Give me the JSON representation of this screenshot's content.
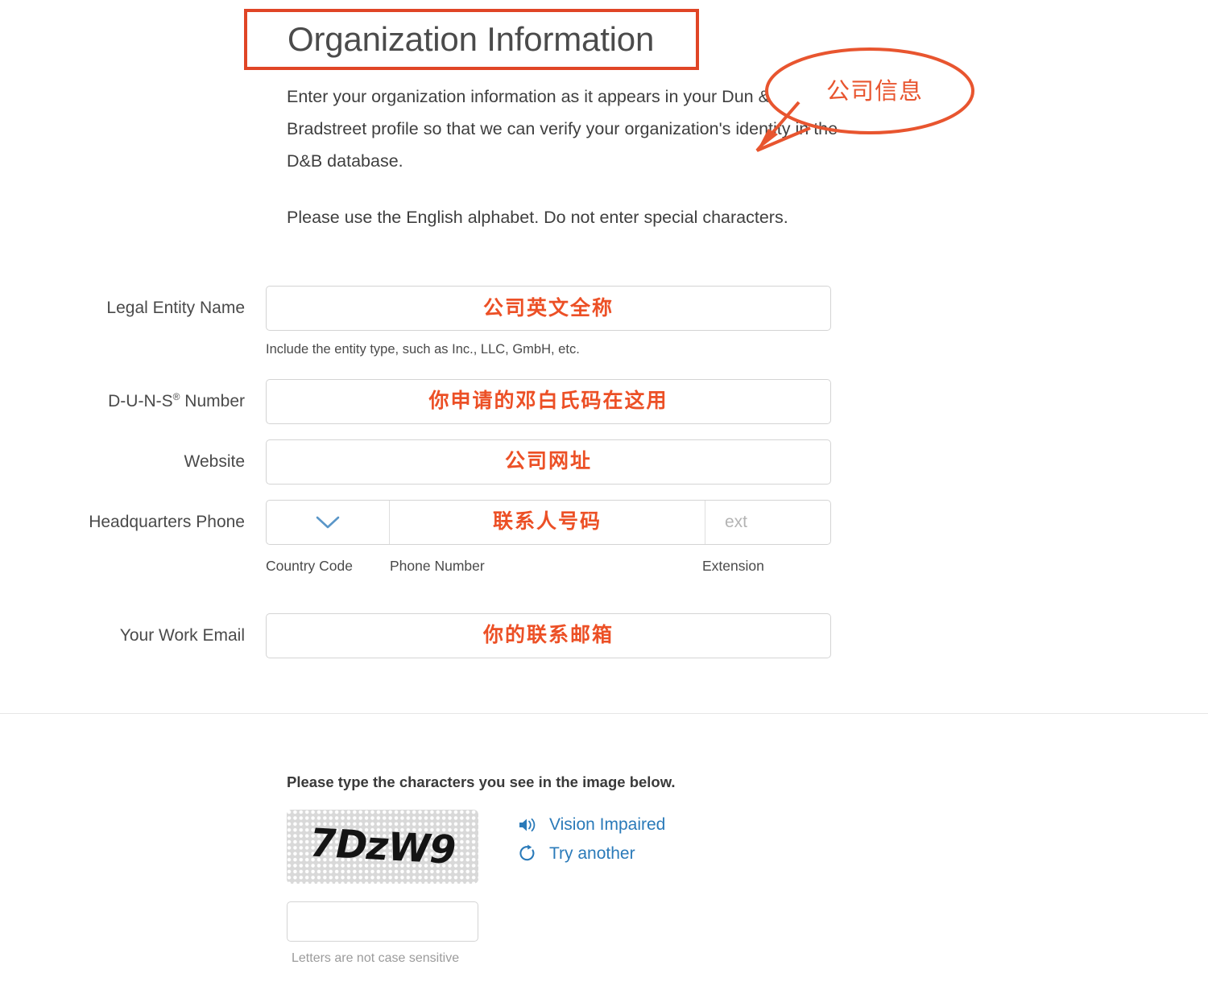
{
  "page": {
    "title": "Organization Information",
    "intro_paragraph_1": "Enter your organization information as it appears in your Dun & Bradstreet profile so that we can verify your organization's identity in the D&B database.",
    "intro_paragraph_2": "Please use the English alphabet. Do not enter special characters."
  },
  "annotation": {
    "bubble_text": "公司信息",
    "color": "#e8552f"
  },
  "form": {
    "legal_entity_name": {
      "label": "Legal Entity Name",
      "value": "公司英文全称",
      "help": "Include the entity type, such as Inc., LLC, GmbH, etc."
    },
    "duns_number": {
      "label_main": "D-U-N-S",
      "label_sup": "®",
      "label_tail": " Number",
      "value": "你申请的邓白氏码在这用"
    },
    "website": {
      "label": "Website",
      "value": "公司网址"
    },
    "headquarters_phone": {
      "label": "Headquarters Phone",
      "country_code_value": "",
      "phone_value": "联系人号码",
      "ext_placeholder": "ext",
      "ext_value": "",
      "sub_label_country_code": "Country Code",
      "sub_label_phone_number": "Phone Number",
      "sub_label_extension": "Extension"
    },
    "work_email": {
      "label": "Your Work Email",
      "value": "你的联系邮箱"
    }
  },
  "captcha": {
    "prompt": "Please type the characters you see in the image below.",
    "image_characters": "7DzW9",
    "vision_impaired_label": "Vision Impaired",
    "try_another_label": "Try another",
    "input_value": "",
    "note": "Letters are not case sensitive",
    "link_color": "#2a7ab9"
  }
}
